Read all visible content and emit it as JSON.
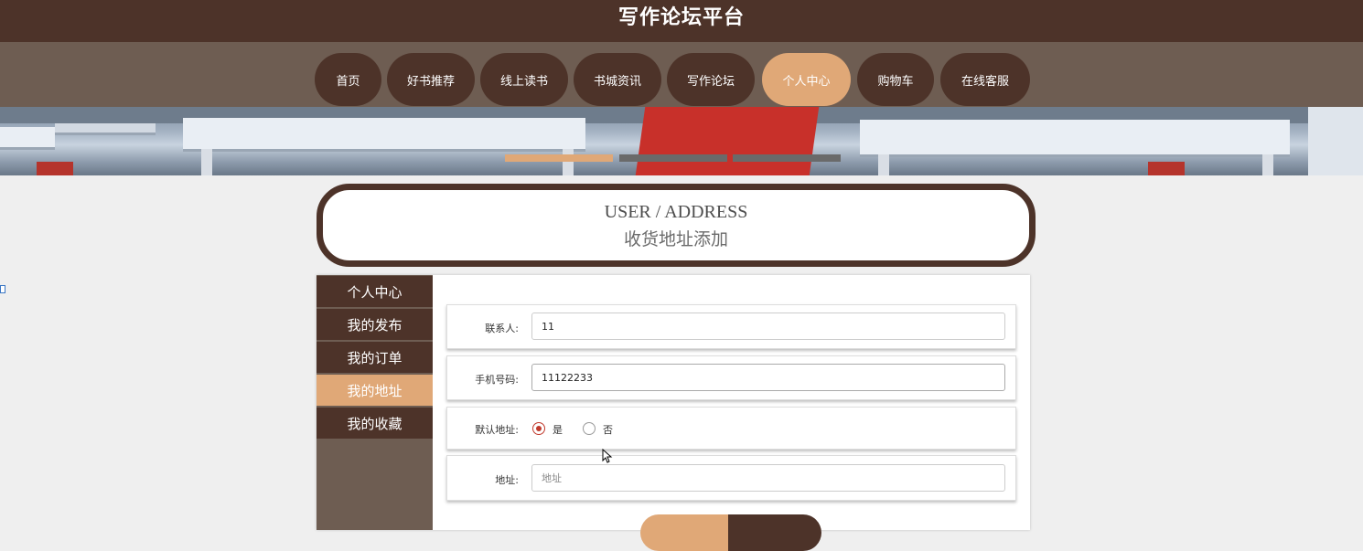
{
  "header": {
    "title": "写作论坛平台"
  },
  "nav": {
    "items": [
      {
        "label": "首页",
        "active": false
      },
      {
        "label": "好书推荐",
        "active": false
      },
      {
        "label": "线上读书",
        "active": false
      },
      {
        "label": "书城资讯",
        "active": false
      },
      {
        "label": "写作论坛",
        "active": false
      },
      {
        "label": "个人中心",
        "active": true
      },
      {
        "label": "购物车",
        "active": false
      },
      {
        "label": "在线客服",
        "active": false
      }
    ]
  },
  "banner": {
    "active_slide": 1,
    "slide_count": 3
  },
  "page_title": {
    "en": "USER / ADDRESS",
    "cn": "收货地址添加"
  },
  "sidebar": {
    "items": [
      {
        "label": "个人中心",
        "active": false
      },
      {
        "label": "我的发布",
        "active": false
      },
      {
        "label": "我的订单",
        "active": false
      },
      {
        "label": "我的地址",
        "active": true
      },
      {
        "label": "我的收藏",
        "active": false
      }
    ]
  },
  "form": {
    "contact": {
      "label": "联系人:",
      "value": "11"
    },
    "phone": {
      "label": "手机号码:",
      "value": "11122233"
    },
    "default_address": {
      "label": "默认地址:",
      "options": [
        "是",
        "否"
      ],
      "selected": "是"
    },
    "address": {
      "label": "地址:",
      "placeholder": "地址",
      "value": ""
    }
  },
  "colors": {
    "brand_dark": "#4d3329",
    "brand_mid": "#6e5d52",
    "accent": "#e0a877",
    "radio_selected": "#c0392b"
  }
}
